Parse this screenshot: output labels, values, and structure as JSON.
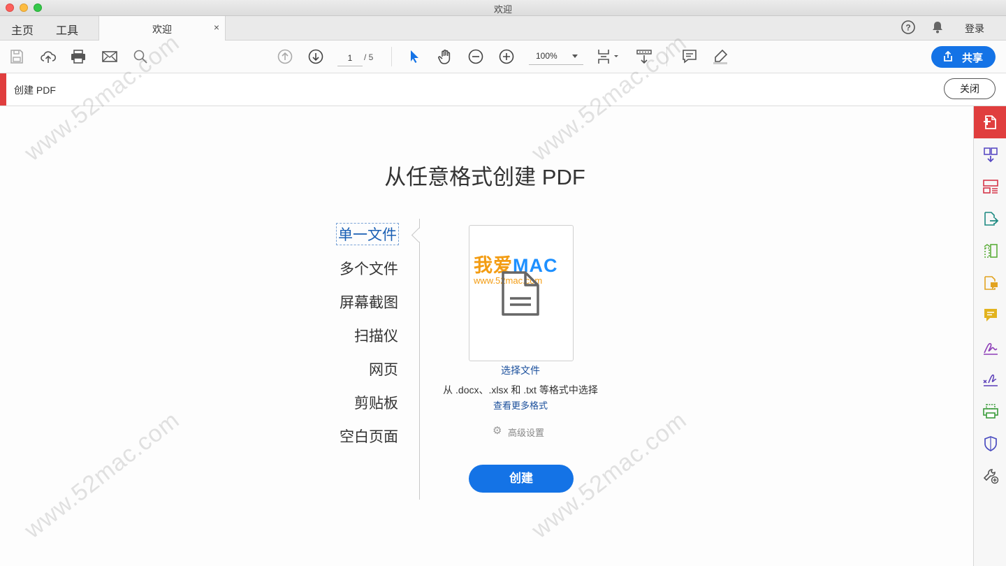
{
  "window": {
    "title": "欢迎"
  },
  "tabs": {
    "home": "主页",
    "tools": "工具",
    "doc_tab": "欢迎",
    "close_tab": "×",
    "login": "登录"
  },
  "toolbar": {
    "page_current": "1",
    "page_total": "/ 5",
    "zoom": "100%",
    "share": "共享"
  },
  "tool_header": {
    "name": "创建 PDF",
    "close": "关闭"
  },
  "main": {
    "title": "从任意格式创建 PDF",
    "sources": [
      "单一文件",
      "多个文件",
      "屏幕截图",
      "扫描仪",
      "网页",
      "剪贴板",
      "空白页面"
    ],
    "selected_source": "单一文件",
    "choose_file": "选择文件",
    "formats_text": "从 .docx、.xlsx 和 .txt 等格式中选择",
    "more_formats": "查看更多格式",
    "advanced": "高级设置",
    "create": "创建"
  },
  "watermark": {
    "logo_a": "我爱",
    "logo_b": "MAC",
    "url": "www.52mac.com",
    "text": "www.52mac.com"
  },
  "colors": {
    "accent": "#1473e6",
    "tool_red": "#e03e3e",
    "link": "#1a4f9c"
  },
  "right_panel_icons": [
    "create-pdf-icon",
    "combine-files-icon",
    "organize-pages-icon",
    "export-pdf-icon",
    "edit-pdf-icon",
    "comment-file-icon",
    "comment-icon",
    "fill-sign-icon",
    "send-signature-icon",
    "print-production-icon",
    "protect-icon",
    "more-tools-icon"
  ]
}
